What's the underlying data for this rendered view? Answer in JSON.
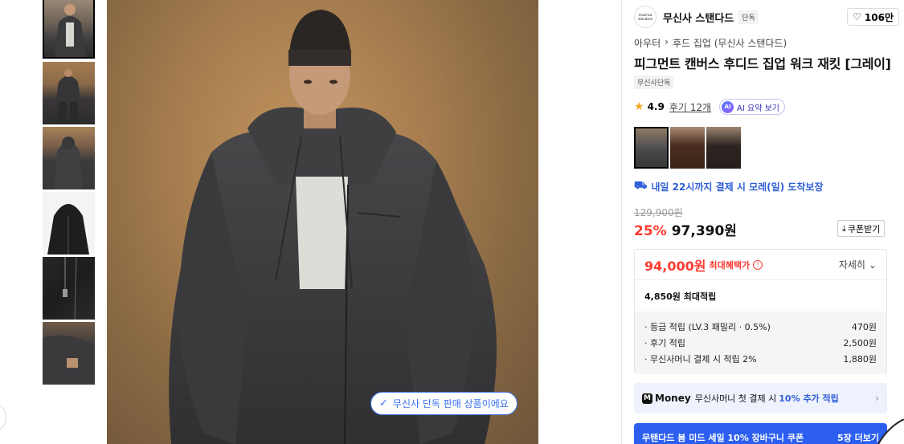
{
  "brand": {
    "logo_text": "musinsa standard",
    "name": "무신사 스탠다드",
    "tag": "단독"
  },
  "like": {
    "icon": "heart-icon",
    "count": "106만"
  },
  "breadcrumb": {
    "category": "아우터",
    "separator": "›",
    "sub": "후드 집업 (무신사 스탠다드)"
  },
  "product": {
    "title": "피그먼트 캔버스 후디드 집업 워크 재킷 [그레이]",
    "exclusive_tag": "무신사단독"
  },
  "rating": {
    "score": "4.9",
    "reviews": "후기 12개",
    "ai_icon": "AI",
    "ai_label": "AI 요약 보기"
  },
  "delivery": {
    "text": "내일 22시까지 결제 시 모레(일) 도착보장"
  },
  "price": {
    "original": "129,900원",
    "discount": "25%",
    "sale": "97,390원",
    "coupon_label": "쿠폰받기",
    "coupon_icon": "⤓"
  },
  "benefit": {
    "max_price": "94,000원",
    "max_label": "최대혜택가",
    "info_icon": "!",
    "detail_label": "자세히",
    "points_title": "4,850원 최대적립",
    "items": [
      {
        "label": "· 등급 적립 (LV.3 패밀리 · 0.5%)",
        "value": "470원"
      },
      {
        "label": "· 후기 적립",
        "value": "2,500원"
      },
      {
        "label": "· 무신사머니 결제 시 적립 2%",
        "value": "1,880원"
      }
    ]
  },
  "money_banner": {
    "logo_mark": "M",
    "logo": "Money",
    "text": "무신사머니 첫 결제 시",
    "highlight": "10% 추가 적립",
    "arrow": "›"
  },
  "sale_banner": {
    "text": "무탠다드 봄 미드 세일 10% 장바구니 쿠폰",
    "more": "5장 더보기"
  },
  "image_badge": {
    "check": "✓",
    "text": "무신사 단독 판매 상품이에요"
  }
}
